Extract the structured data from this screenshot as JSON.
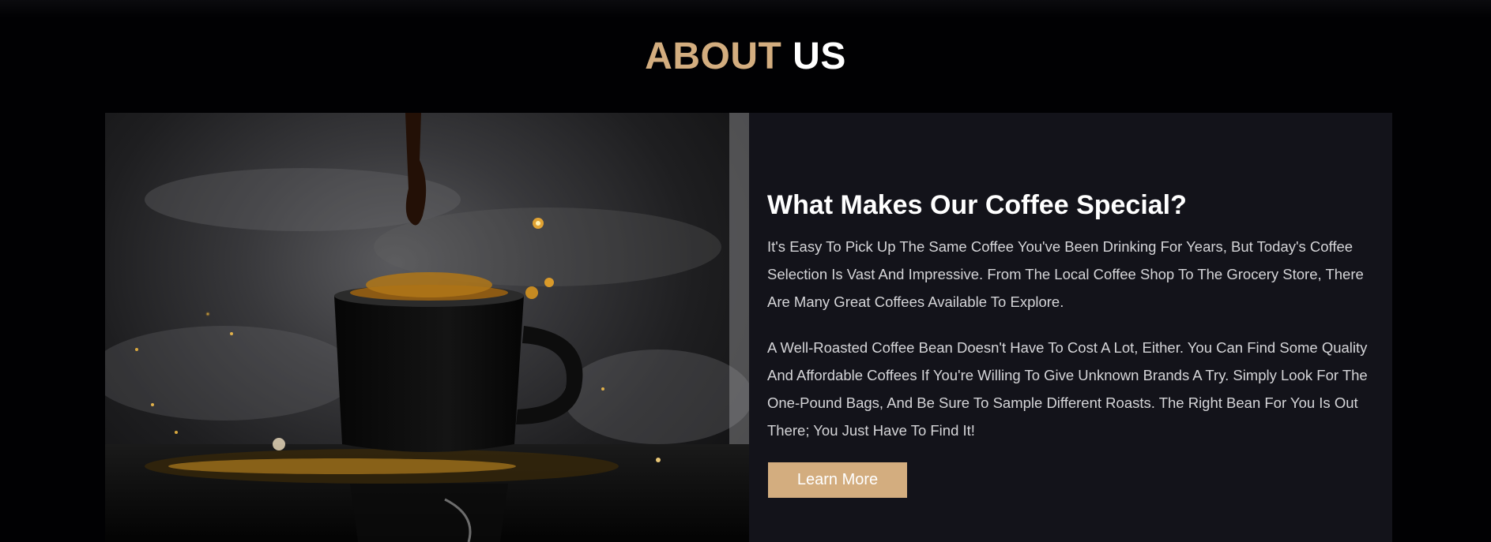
{
  "about": {
    "title_accent": "ABOUT",
    "title_rest": "US"
  },
  "content": {
    "heading": "What Makes Our Coffee Special?",
    "paragraph1": "It's Easy To Pick Up The Same Coffee You've Been Drinking For Years, But Today's Coffee Selection Is Vast And Impressive. From The Local Coffee Shop To The Grocery Store, There Are Many Great Coffees Available To Explore.",
    "paragraph2": "A Well-Roasted Coffee Bean Doesn't Have To Cost A Lot, Either. You Can Find Some Quality And Affordable Coffees If You're Willing To Give Unknown Brands A Try. Simply Look For The One-Pound Bags, And Be Sure To Sample Different Roasts. The Right Bean For You Is Out There; You Just Have To Find It!",
    "button_label": "Learn More"
  },
  "colors": {
    "background": "#010103",
    "accent": "#d3ad7f",
    "panel": "#13131a"
  },
  "image": {
    "icon": "coffee-cup-photo"
  }
}
